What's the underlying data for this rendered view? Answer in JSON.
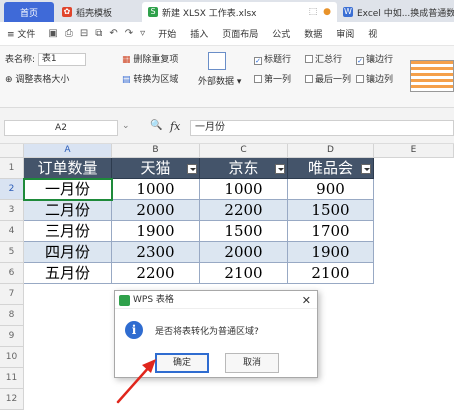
{
  "tabs": {
    "home": "首页",
    "template": "稻壳模板",
    "active_file": "新建 XLSX 工作表.xlsx",
    "other": "Excel 中如...换成普通数",
    "dot": "●",
    "pin_icon": "⬚"
  },
  "menu": {
    "file": "≡ 文件",
    "items": [
      "开始",
      "插入",
      "页面布局",
      "公式",
      "数据",
      "审阅",
      "视"
    ]
  },
  "ribbon": {
    "table_name_label": "表名称:",
    "table_name_value": "表1",
    "resize_table": "调整表格大小",
    "remove_duplicates": "删除重复项",
    "convert_to_range": "转换为区域",
    "external_data": "外部数据",
    "header_row": "标题行",
    "total_row": "汇总行",
    "banded_rows": "镶边行",
    "first_column": "第一列",
    "last_column": "最后一列",
    "banded_columns": "镶边列"
  },
  "formula_bar": {
    "cell_ref": "A2",
    "fx": "fx",
    "zoom_icon": "🔍",
    "value": "一月份"
  },
  "grid": {
    "columns": [
      "A",
      "B",
      "C",
      "D",
      "E"
    ],
    "rows": [
      "1",
      "2",
      "3",
      "4",
      "5",
      "6",
      "7",
      "8",
      "9",
      "10",
      "11",
      "12"
    ],
    "header": [
      "订单数量",
      "天猫",
      "京东",
      "唯品会"
    ],
    "data": [
      [
        "一月份",
        "1000",
        "1000",
        "900"
      ],
      [
        "二月份",
        "2000",
        "2200",
        "1500"
      ],
      [
        "三月份",
        "1900",
        "1500",
        "1700"
      ],
      [
        "四月份",
        "2300",
        "2000",
        "1900"
      ],
      [
        "五月份",
        "2200",
        "2100",
        "2100"
      ]
    ]
  },
  "dialog": {
    "title": "WPS 表格",
    "close": "✕",
    "message": "是否将表转化为普通区域?",
    "info_icon": "i",
    "ok": "确定",
    "cancel": "取消"
  },
  "colors": {
    "table_header": "#44546a",
    "band": "#dce6f1",
    "active_cell": "#1e8a3a",
    "arrow": "#e0261c"
  }
}
